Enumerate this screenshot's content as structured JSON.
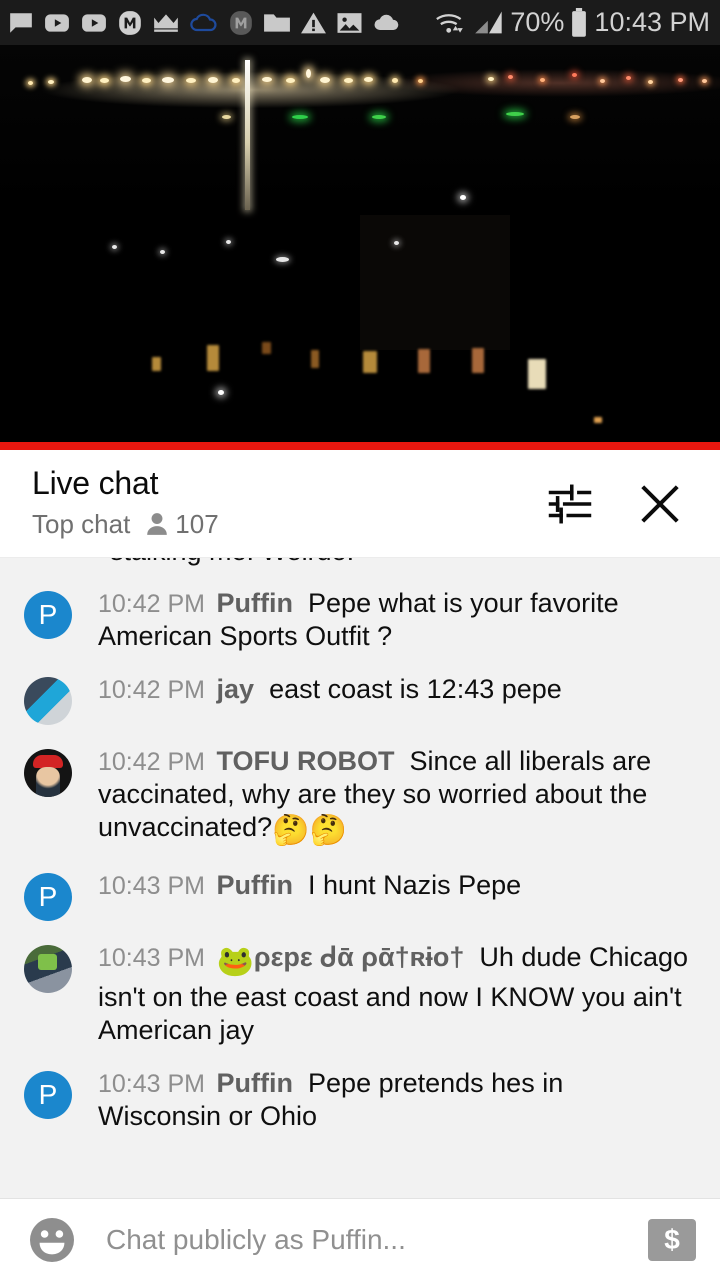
{
  "status_bar": {
    "icons": [
      {
        "name": "message-icon"
      },
      {
        "name": "youtube-icon"
      },
      {
        "name": "youtube-icon"
      },
      {
        "name": "monogram-m-icon"
      },
      {
        "name": "crown-icon"
      },
      {
        "name": "cloud-outline-icon"
      },
      {
        "name": "monogram-m-dark-icon"
      },
      {
        "name": "folder-icon"
      },
      {
        "name": "warning-triangle-icon"
      },
      {
        "name": "image-icon"
      },
      {
        "name": "cloud-filled-icon"
      }
    ],
    "wifi_icon": "wifi-icon",
    "signal_icon": "signal-bars-icon",
    "battery_percent": "70%",
    "battery_icon": "battery-icon",
    "time": "10:43 PM"
  },
  "video": {
    "description": "night cityscape live stream",
    "progress_color": "#e8170f"
  },
  "chat_header": {
    "title": "Live chat",
    "subtitle": "Top chat",
    "viewer_icon": "person-icon",
    "viewer_count": "107",
    "settings_icon": "chat-settings-icon",
    "close_icon": "close-icon"
  },
  "messages": [
    {
      "clipped": true,
      "text": "stalking me. Weirdo."
    },
    {
      "avatar_type": "letter",
      "avatar_letter": "P",
      "avatar_color": "#1b87cd",
      "timestamp": "10:42 PM",
      "author": "Puffin",
      "text": "Pepe what is your favorite American Sports Outfit ?"
    },
    {
      "avatar_type": "photo1",
      "timestamp": "10:42 PM",
      "author": "jay",
      "text": "east coast is 12:43 pepe"
    },
    {
      "avatar_type": "photo2",
      "timestamp": "10:42 PM",
      "author": "TOFU ROBOT",
      "text": "Since all liberals are vaccinated, why are they so worried about the unvaccinated?",
      "trailing_emoji": "🤔🤔"
    },
    {
      "avatar_type": "letter",
      "avatar_letter": "P",
      "avatar_color": "#1b87cd",
      "timestamp": "10:43 PM",
      "author": "Puffin",
      "text": "I hunt Nazis Pepe"
    },
    {
      "avatar_type": "photo3",
      "timestamp": "10:43 PM",
      "author_emoji": "🐸",
      "author": "ρεpε ᑯᾱ ρᾱ†ʀɨο†",
      "text": "Uh dude Chicago isn't on the east coast and now I KNOW you ain't American jay"
    },
    {
      "avatar_type": "letter",
      "avatar_letter": "P",
      "avatar_color": "#1b87cd",
      "timestamp": "10:43 PM",
      "author": "Puffin",
      "text": "Pepe pretends hes in Wisconsin or Ohio"
    }
  ],
  "input_bar": {
    "emoji_icon": "emoji-face-icon",
    "placeholder": "Chat publicly as Puffin...",
    "superchat_icon": "super-chat-dollar-icon",
    "superchat_glyph": "$"
  }
}
